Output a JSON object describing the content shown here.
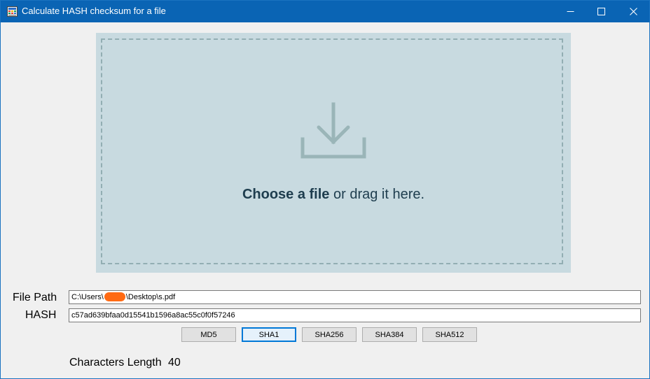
{
  "window": {
    "title": "Calculate HASH checksum for a file",
    "controls": [
      "minimize-icon",
      "maximize-icon",
      "close-icon"
    ]
  },
  "dropzone": {
    "icon": "download-icon",
    "choose_text": "Choose a file",
    "drag_text": " or drag it here."
  },
  "form": {
    "file_path_label": "File Path",
    "file_path_prefix": "C:\\Users\\",
    "file_path_suffix": "\\Desktop\\s.pdf",
    "hash_label": "HASH",
    "hash_value": "c57ad639bfaa0d15541b1596a8ac55c0f0f57246"
  },
  "buttons": {
    "md5": "MD5",
    "sha1": "SHA1",
    "sha256": "SHA256",
    "sha384": "SHA384",
    "sha512": "SHA512",
    "selected": "SHA1"
  },
  "result": {
    "length_label": "Characters Length",
    "length_value": "40"
  },
  "colors": {
    "titlebar": "#0a64b4",
    "dropzone_bg": "#c8dae0",
    "dropzone_border": "#92aeb3",
    "icon": "#9ab5b8",
    "dropzone_text": "#1e3d4e",
    "selected_button_border": "#0078d7",
    "redaction": "#ff6a13"
  }
}
